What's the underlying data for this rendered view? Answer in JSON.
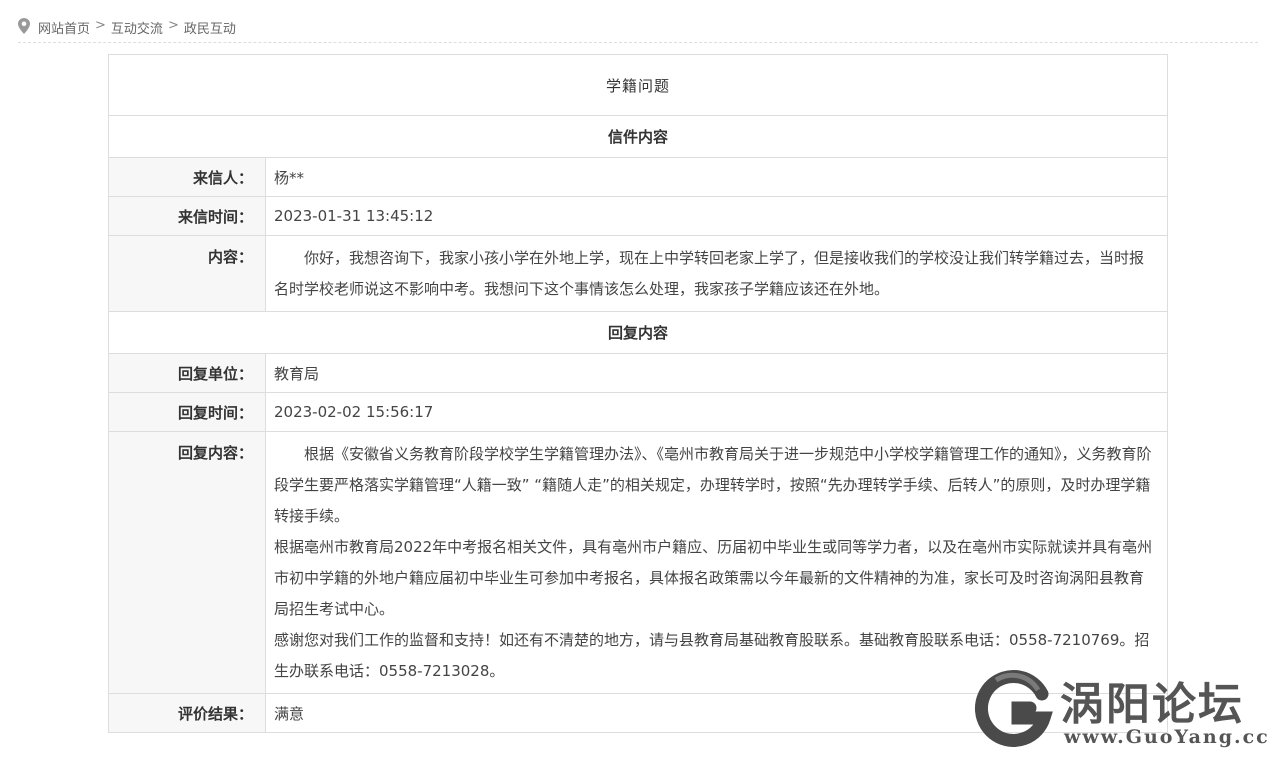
{
  "breadcrumb": {
    "items": [
      "网站首页",
      "互动交流",
      "政民互动"
    ],
    "separator": ">"
  },
  "letter": {
    "title": "学籍问题",
    "letter_section": "信件内容",
    "sender_label": "来信人：",
    "sender": "杨**",
    "time_label": "来信时间：",
    "time": "2023-01-31 13:45:12",
    "content_label": "内容：",
    "content": "你好，我想咨询下，我家小孩小学在外地上学，现在上中学转回老家上学了，但是接收我们的学校没让我们转学籍过去，当时报名时学校老师说这不影响中考。我想问下这个事情该怎么处理，我家孩子学籍应该还在外地。"
  },
  "reply": {
    "reply_section": "回复内容",
    "unit_label": "回复单位：",
    "unit": "教育局",
    "time_label": "回复时间：",
    "time": "2023-02-02 15:56:17",
    "content_label": "回复内容：",
    "paragraphs": [
      "根据《安徽省义务教育阶段学校学生学籍管理办法》、《亳州市教育局关于进一步规范中小学校学籍管理工作的通知》，义务教育阶段学生要严格落实学籍管理“人籍一致” “籍随人走”的相关规定，办理转学时，按照“先办理转学手续、后转人”的原则，及时办理学籍转接手续。",
      "根据亳州市教育局2022年中考报名相关文件，具有亳州市户籍应、历届初中毕业生或同等学力者，以及在亳州市实际就读并具有亳州市初中学籍的外地户籍应届初中毕业生可参加中考报名，具体报名政策需以今年最新的文件精神的为准，家长可及时咨询涡阳县教育局招生考试中心。",
      "感谢您对我们工作的监督和支持！如还有不清楚的地方，请与县教育局基础教育股联系。基础教育股联系电话：0558-7210769。招生办联系电话：0558-7213028。"
    ]
  },
  "evaluation": {
    "label": "评价结果：",
    "value": "满意"
  },
  "watermark": {
    "name": "涡阳论坛",
    "url": "www.GuoYang.cc"
  },
  "colors": {
    "border": "#dddddd",
    "label_bg": "#f7f7f7",
    "text": "#333333",
    "watermark": "#555555"
  },
  "icons": {
    "breadcrumb_icon": "location-pin-icon",
    "watermark_logo": "g-logo-icon"
  }
}
